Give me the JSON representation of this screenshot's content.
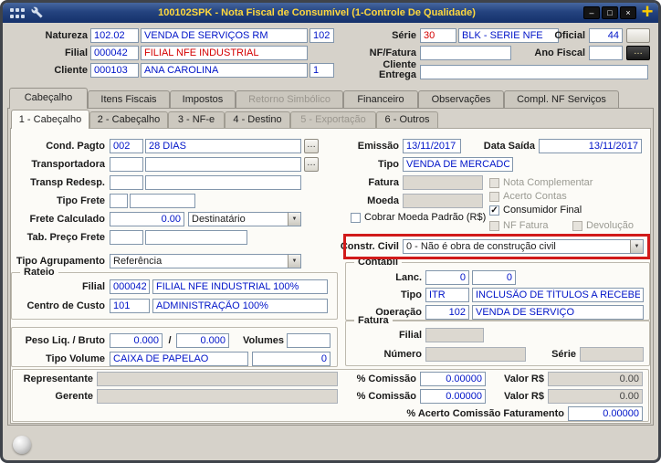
{
  "colors": {
    "titlebar_top": "#46679f",
    "titlebar_bottom": "#15316b",
    "title_text": "#ffd83d",
    "plus_button": "#ffcc00",
    "field_value": "#0014c8",
    "alert_value": "#d40000",
    "highlight_box": "#d11a1a"
  },
  "window": {
    "title": "100102SPK - Nota Fiscal de Consumível (1-Controle De Qualidade)",
    "minimize_glyph": "–",
    "maximize_glyph": "□",
    "close_glyph": "×",
    "plus_glyph": "+"
  },
  "ui": {
    "browse": "…",
    "arrow": "▼",
    "slash": "/"
  },
  "header": {
    "natureza": {
      "label": "Natureza",
      "code": "102.02",
      "name": "VENDA DE SERVIÇOS RM",
      "num": "102"
    },
    "serie": {
      "label": "Série",
      "code": "30",
      "name": "BLK - SERIE NFE"
    },
    "oficial": {
      "label": "Oficial",
      "value": "44"
    },
    "filial": {
      "label": "Filial",
      "code": "000042",
      "name": "FILIAL NFE INDUSTRIAL"
    },
    "nf_fatura": {
      "label": "NF/Fatura",
      "value": ""
    },
    "ano_fiscal": {
      "label": "Ano Fiscal",
      "value": ""
    },
    "cliente": {
      "label": "Cliente",
      "code": "000103",
      "name": "ANA CAROLINA",
      "num": "1"
    },
    "cliente_entrega": {
      "label_line1": "Cliente",
      "label_line2": "Entrega",
      "value": ""
    }
  },
  "tabs": [
    {
      "label": "Cabeçalho",
      "state": "active"
    },
    {
      "label": "Itens Fiscais",
      "state": "normal"
    },
    {
      "label": "Impostos",
      "state": "normal"
    },
    {
      "label": "Retorno Simbólico",
      "state": "disabled"
    },
    {
      "label": "Financeiro",
      "state": "normal"
    },
    {
      "label": "Observações",
      "state": "normal"
    },
    {
      "label": "Compl. NF Serviços",
      "state": "normal"
    }
  ],
  "subtabs": [
    {
      "label": "1 - Cabeçalho",
      "state": "active"
    },
    {
      "label": "2 - Cabeçalho",
      "state": "normal"
    },
    {
      "label": "3 - NF-e",
      "state": "normal"
    },
    {
      "label": "4 - Destino",
      "state": "normal"
    },
    {
      "label": "5 - Exportação",
      "state": "disabled"
    },
    {
      "label": "6 - Outros",
      "state": "normal"
    }
  ],
  "form": {
    "cond_pagto": {
      "label": "Cond. Pagto",
      "code": "002",
      "name": "28 DIAS"
    },
    "transportadora": {
      "label": "Transportadora",
      "code": "",
      "name": ""
    },
    "transp_redesp": {
      "label": "Transp Redesp.",
      "code": "",
      "name": ""
    },
    "tipo_frete": {
      "label": "Tipo Frete",
      "code": "",
      "name": ""
    },
    "frete_calculado": {
      "label": "Frete Calculado",
      "value": "0.00",
      "modalidade": "Destinatário"
    },
    "tab_preco_frete": {
      "label": "Tab. Preço Frete",
      "code": "",
      "name": ""
    },
    "tipo_agrupamento": {
      "label": "Tipo Agrupamento",
      "value": "Referência"
    },
    "emissao": {
      "label": "Emissão",
      "value": "13/11/2017"
    },
    "data_saida": {
      "label": "Data Saída",
      "value": "13/11/2017"
    },
    "tipo": {
      "label": "Tipo",
      "value": "VENDA DE MERCADORI"
    },
    "fatura": {
      "label": "Fatura",
      "value": ""
    },
    "moeda": {
      "label": "Moeda",
      "value": ""
    },
    "checks": {
      "nota_complementar": {
        "label": "Nota Complementar",
        "mark": "",
        "enabled": false
      },
      "acerto_contas": {
        "label": "Acerto Contas",
        "mark": "",
        "enabled": false
      },
      "consumidor_final": {
        "label": "Consumidor Final",
        "mark": "✓",
        "enabled": true
      },
      "cobrar_moeda_padrao": {
        "label": "Cobrar Moeda Padrão (R$)",
        "mark": "",
        "enabled": true
      },
      "nf_fatura": {
        "label": "NF Fatura",
        "mark": "",
        "enabled": false
      },
      "devolucao": {
        "label": "Devolução",
        "mark": "",
        "enabled": false
      }
    },
    "constr_civil": {
      "label": "Constr. Civil",
      "value": "0 - Não é obra de construção civil"
    },
    "rateio": {
      "title": "Rateio",
      "filial": {
        "label": "Filial",
        "code": "000042",
        "name": "FILIAL NFE INDUSTRIAL 100%"
      },
      "centro_custo": {
        "label": "Centro de Custo",
        "code": "101",
        "name": "ADMINISTRAÇÃO 100%"
      }
    },
    "contabil": {
      "title": "Contábil",
      "lanc": {
        "label": "Lanc.",
        "value1": "0",
        "value2": "0"
      },
      "tipo": {
        "label": "Tipo",
        "code": "ITR",
        "name": "INCLUSÃO DE TÍTULOS A RECEBER"
      },
      "operacao": {
        "label": "Operação",
        "code": "102",
        "name": "VENDA DE SERVIÇO"
      }
    },
    "fatura_group": {
      "title": "Fatura",
      "filial": {
        "label": "Filial",
        "value": ""
      },
      "numero": {
        "label": "Número",
        "value": ""
      },
      "serie": {
        "label": "Série",
        "value": ""
      }
    },
    "peso": {
      "label": "Peso Liq. / Bruto",
      "liquido": "0.000",
      "bruto": "0.000",
      "volumes_label": "Volumes",
      "volumes": "",
      "tipo_volume_label": "Tipo Volume",
      "tipo_volume": "CAIXA DE PAPELAO",
      "quantidade": "0"
    },
    "comissao": {
      "representante_label": "Representante",
      "representante": "",
      "gerente_label": "Gerente",
      "gerente": "",
      "pct_comissao_label": "% Comissão",
      "valor_label": "Valor R$",
      "representante_pct": "0.00000",
      "representante_valor": "0.00",
      "gerente_pct": "0.00000",
      "gerente_valor": "0.00",
      "acerto_label": "% Acerto Comissão Faturamento",
      "acerto_pct": "0.00000"
    }
  }
}
